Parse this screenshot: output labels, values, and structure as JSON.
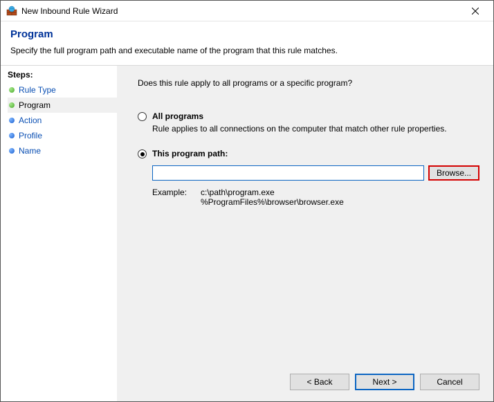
{
  "window": {
    "title": "New Inbound Rule Wizard"
  },
  "header": {
    "title": "Program",
    "subtitle": "Specify the full program path and executable name of the program that this rule matches."
  },
  "sidebar": {
    "title": "Steps:",
    "items": [
      {
        "label": "Rule Type"
      },
      {
        "label": "Program"
      },
      {
        "label": "Action"
      },
      {
        "label": "Profile"
      },
      {
        "label": "Name"
      }
    ]
  },
  "main": {
    "question": "Does this rule apply to all programs or a specific program?",
    "option_all": {
      "label": "All programs",
      "desc": "Rule applies to all connections on the computer that match other rule properties."
    },
    "option_path": {
      "label": "This program path:",
      "value": "",
      "browse": "Browse...",
      "example_label": "Example:",
      "example_paths": "c:\\path\\program.exe\n%ProgramFiles%\\browser\\browser.exe"
    }
  },
  "footer": {
    "back": "< Back",
    "next": "Next >",
    "cancel": "Cancel"
  }
}
